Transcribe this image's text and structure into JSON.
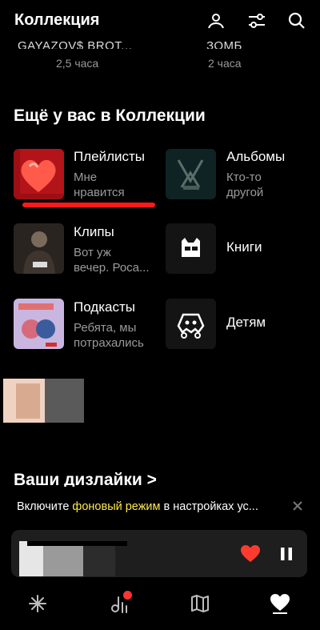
{
  "header": {
    "title": "Коллекция",
    "icons": [
      "profile-icon",
      "filters-icon",
      "search-icon"
    ]
  },
  "prev_row": [
    {
      "title": "GAYAZOV$ BROT...",
      "subtitle": "2,5 часа"
    },
    {
      "title": "ЗОМБ",
      "subtitle": "2 часа"
    }
  ],
  "section_title": "Ещё у вас в Коллекции",
  "items": [
    {
      "title": "Плейлисты",
      "sub1": "Мне",
      "sub2": "нравится",
      "icon": "heart-cover"
    },
    {
      "title": "Альбомы",
      "sub1": "Кто-то",
      "sub2": "другой",
      "icon": "album-cover"
    },
    {
      "title": "Клипы",
      "sub1": "Вот уж",
      "sub2": "вечер. Роса...",
      "icon": "clip-cover"
    },
    {
      "title": "Книги",
      "icon": "books-icon"
    },
    {
      "title": "Подкасты",
      "sub1": "Ребята, мы",
      "sub2": "потрахались",
      "icon": "podcast-cover"
    },
    {
      "title": "Детям",
      "icon": "kids-icon"
    }
  ],
  "dislikes_title": "Ваши дизлайки >",
  "notice": {
    "prefix": "Включите ",
    "highlight": "фоновый режим",
    "suffix": " в настройках ус..."
  },
  "colors": {
    "accent_red": "#ff1a1a",
    "highlight_yellow": "#ffe94d",
    "heart_red": "#ff3b30"
  },
  "bottom_nav": [
    "wave-icon",
    "music-trends-icon",
    "map-icon",
    "collection-heart-icon"
  ]
}
